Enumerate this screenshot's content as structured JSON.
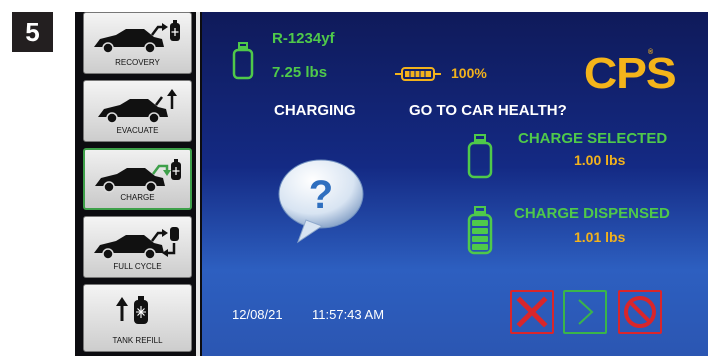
{
  "step_number": "5",
  "sidebar": {
    "items": [
      {
        "label": "RECOVERY",
        "icon": "car-recovery-icon"
      },
      {
        "label": "EVACUATE",
        "icon": "car-evacuate-icon"
      },
      {
        "label": "CHARGE",
        "icon": "car-charge-icon",
        "active": true
      },
      {
        "label": "FULL CYCLE",
        "icon": "car-full-cycle-icon"
      },
      {
        "label": "TANK REFILL",
        "icon": "tank-refill-icon"
      }
    ]
  },
  "tank": {
    "refrigerant": "R-1234yf",
    "weight": "7.25 lbs"
  },
  "battery": {
    "percent": "100%",
    "level": 1.0
  },
  "brand": {
    "logo_text": "CPS",
    "registered": "®"
  },
  "status": {
    "mode": "CHARGING",
    "prompt": "GO TO CAR HEALTH?"
  },
  "charge_selected": {
    "label": "CHARGE SELECTED",
    "value": "1.00 lbs"
  },
  "charge_dispensed": {
    "label": "CHARGE DISPENSED",
    "value": "1.01 lbs"
  },
  "footer": {
    "date": "12/08/21",
    "time": "11:57:43 AM"
  },
  "controls": {
    "cancel_icon": "x-icon",
    "next_icon": "chevron-right-icon",
    "stop_icon": "prohibited-icon"
  },
  "colors": {
    "green": "#4fc94a",
    "gold": "#f2b21c",
    "red": "#d9262b",
    "screen_blue": "#142a84"
  }
}
